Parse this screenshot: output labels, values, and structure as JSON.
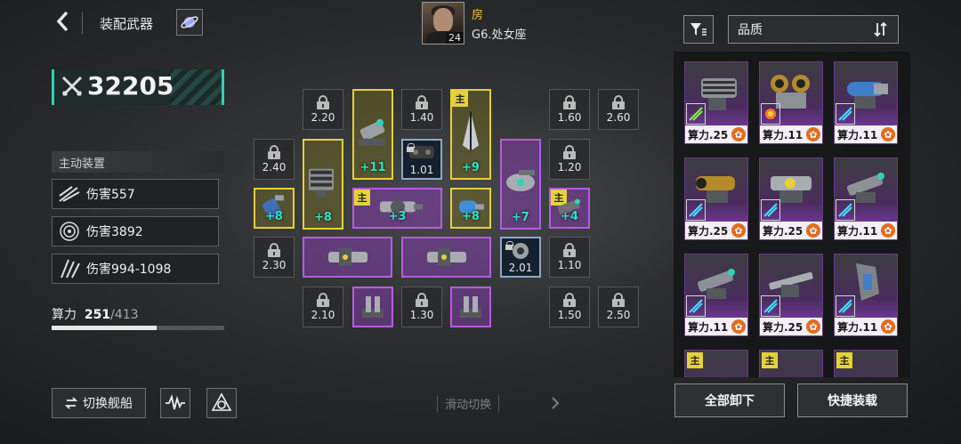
{
  "header": {
    "back_icon": "chevron-left-icon",
    "title": "装配武器",
    "title_icon": "planet-icon"
  },
  "captain": {
    "name": "房",
    "level": "24",
    "subtitle": "G6.处女座"
  },
  "power": {
    "icon": "crossed-swords-icon",
    "value": "32205"
  },
  "active_devices": {
    "heading": "主动装置",
    "items": [
      {
        "icon": "slash-icon",
        "label": "伤害557"
      },
      {
        "icon": "target-ring-icon",
        "label": "伤害3892"
      },
      {
        "icon": "claw-icon",
        "label": "伤害994-1098"
      }
    ]
  },
  "compute": {
    "label": "算力",
    "current": "251",
    "max": "/413",
    "fill_fraction": 0.608
  },
  "bottom_left": {
    "switch_label": "切换舰船",
    "switch_icon": "swap-icon",
    "wave_icon": "waveform-icon",
    "radar_icon": "radar-icon"
  },
  "swipe": {
    "left_icon": "chevron-left-icon",
    "label": "滑动切换",
    "right_icon": "chevron-right-icon"
  },
  "slots": {
    "locked": [
      "2.20",
      "1.40",
      "1.60",
      "2.60",
      "2.40",
      "1.20",
      "2.30",
      "1.10",
      "2.10",
      "1.30",
      "1.50",
      "2.50"
    ],
    "equipped": [
      {
        "id": "a",
        "plus": "+11"
      },
      {
        "id": "b",
        "cost": "1.01"
      },
      {
        "id": "c",
        "tag": "主",
        "plus": "+9"
      },
      {
        "id": "d",
        "plus": "+8"
      },
      {
        "id": "e",
        "plus": "+7"
      },
      {
        "id": "f",
        "plus": "+8"
      },
      {
        "id": "g",
        "tag": "主",
        "plus": "+3"
      },
      {
        "id": "h",
        "plus": "+8"
      },
      {
        "id": "i",
        "tag": "主",
        "plus": "+4"
      },
      {
        "id": "j"
      },
      {
        "id": "k"
      },
      {
        "id": "l",
        "cost": "2.01"
      },
      {
        "id": "m"
      },
      {
        "id": "n"
      }
    ]
  },
  "inventory": {
    "filter_icon": "filter-icon",
    "sort_label": "品质",
    "sort_icon": "sort-icon",
    "cards": [
      {
        "stat": "算力.25",
        "skill_icon": "green-slash-icon"
      },
      {
        "stat": "算力.11",
        "skill_icon": "orange-burst-icon"
      },
      {
        "stat": "算力.11",
        "skill_icon": "cyan-slash-icon"
      },
      {
        "stat": "算力.25",
        "skill_icon": "cyan-slash-icon"
      },
      {
        "stat": "算力.25",
        "skill_icon": "cyan-slash-icon"
      },
      {
        "stat": "算力.11",
        "skill_icon": "cyan-slash-icon"
      },
      {
        "stat": "算力.11",
        "skill_icon": "cyan-slash-icon"
      },
      {
        "stat": "算力.25",
        "skill_icon": "cyan-slash-icon"
      },
      {
        "stat": "算力.11",
        "skill_icon": "cyan-slash-icon"
      }
    ],
    "partial_tags": [
      "主",
      "主",
      "主"
    ],
    "unload_all": "全部卸下",
    "quick_equip": "快捷装载"
  },
  "colors": {
    "accent_teal": "#2fd2b4",
    "gold": "#e6cf3a",
    "purple": "#b65ce0",
    "captain_name": "#f3c63c"
  }
}
